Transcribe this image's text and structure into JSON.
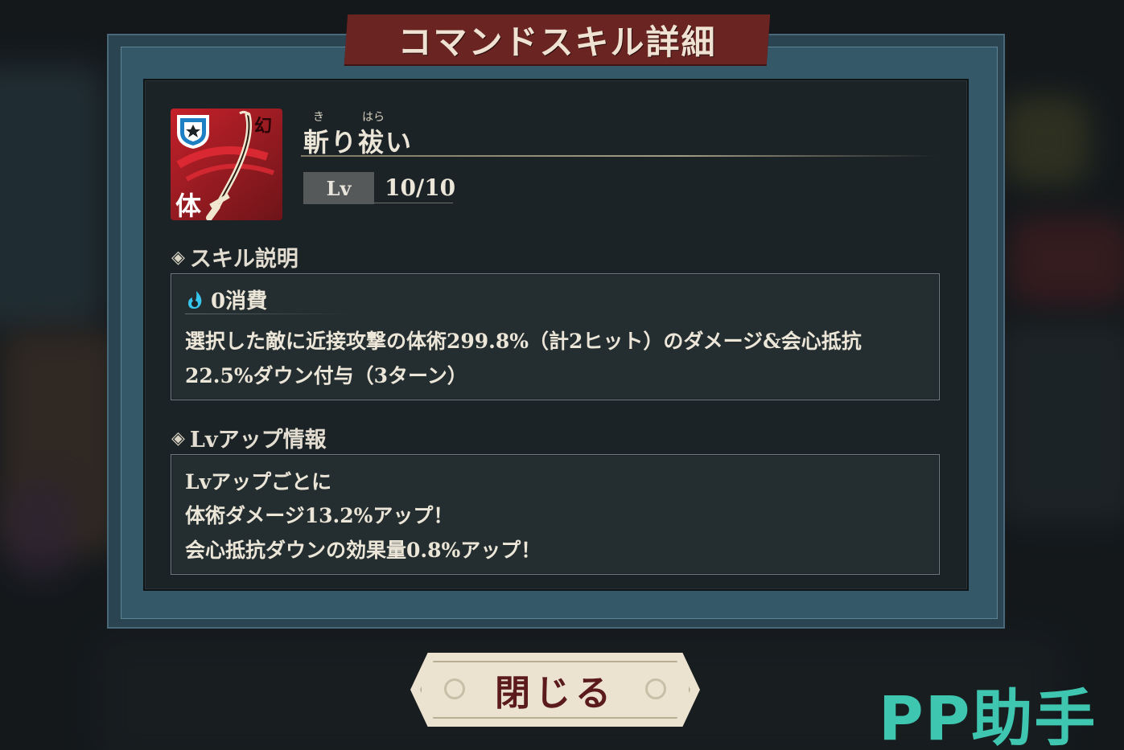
{
  "dialog": {
    "title": "コマンドスキル詳細"
  },
  "skill": {
    "ruby_ki": "き",
    "ruby_hara": "はら",
    "name": "斬り祓い",
    "icon_type_char": "体",
    "icon_corner_mark": "幻",
    "lv_label": "Lv",
    "lv_value": "10/10"
  },
  "description": {
    "header": "スキル説明",
    "cost": "0消費",
    "lines": [
      "選択した敵に近接攻撃の体術299.8%（計2ヒット）のダメージ&会心抵抗",
      "22.5%ダウン付与（3ターン）"
    ]
  },
  "levelup": {
    "header": "Lvアップ情報",
    "lines": [
      "Lvアップごとに",
      "体術ダメージ13.2%アップ！",
      "会心抵抗ダウンの効果量0.8%アップ！"
    ]
  },
  "close_button": {
    "label": "閉じる"
  },
  "watermark": "PP助手",
  "icons": {
    "skill": "katana-skill-icon",
    "shield": "shield-badge-icon",
    "cost": "flame-drop-icon",
    "section": "diamond-bullet-icon"
  },
  "colors": {
    "banner": "#6a2522",
    "panel": "#1b2326",
    "frame": "#355869",
    "accent_cost": "#37c6ee",
    "close_text": "#5b1b1c",
    "watermark": "#3fc6b0"
  }
}
